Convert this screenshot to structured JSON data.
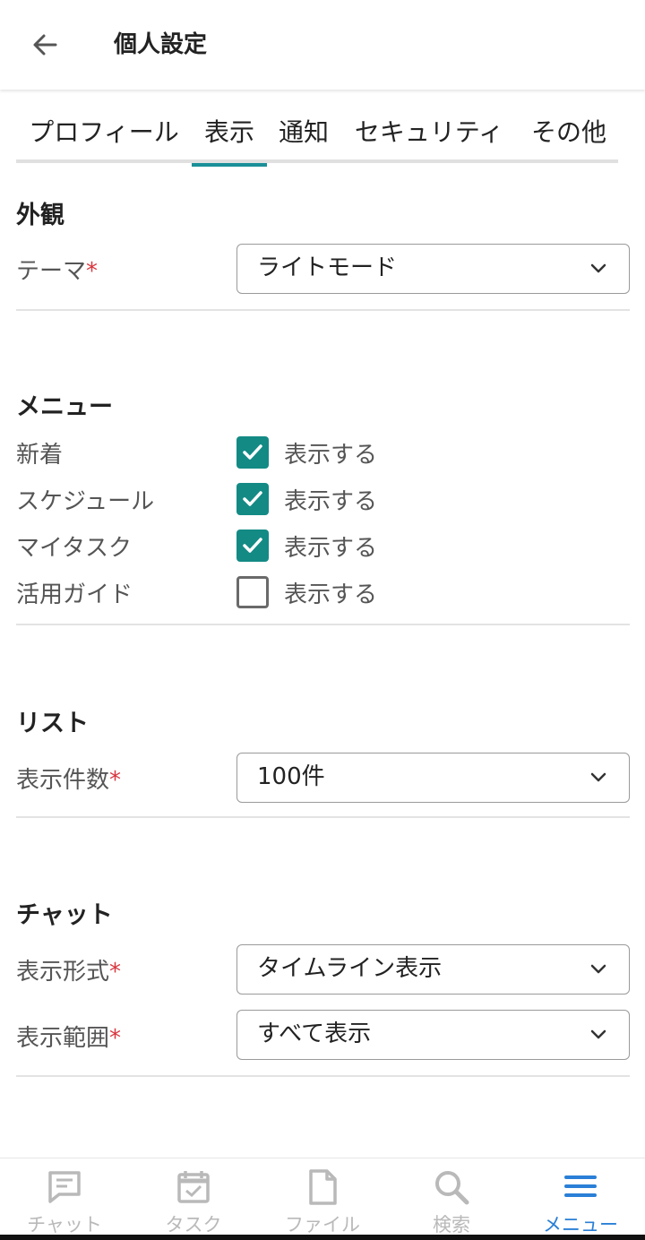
{
  "header": {
    "title": "個人設定"
  },
  "tabs": [
    {
      "label": "プロフィール",
      "active": false
    },
    {
      "label": "表示",
      "active": true
    },
    {
      "label": "通知",
      "active": false
    },
    {
      "label": "セキュリティ",
      "active": false
    },
    {
      "label": "その他",
      "active": false
    }
  ],
  "appearance": {
    "title": "外観",
    "theme": {
      "label": "テーマ",
      "required_mark": "*",
      "value": "ライトモード"
    }
  },
  "menu": {
    "title": "メニュー",
    "items": [
      {
        "label": "新着",
        "option": "表示する",
        "checked": true
      },
      {
        "label": "スケジュール",
        "option": "表示する",
        "checked": true
      },
      {
        "label": "マイタスク",
        "option": "表示する",
        "checked": true
      },
      {
        "label": "活用ガイド",
        "option": "表示する",
        "checked": false
      }
    ]
  },
  "list": {
    "title": "リスト",
    "count": {
      "label": "表示件数",
      "required_mark": "*",
      "value": "100件"
    }
  },
  "chat": {
    "title": "チャット",
    "format": {
      "label": "表示形式",
      "required_mark": "*",
      "value": "タイムライン表示"
    },
    "range": {
      "label": "表示範囲",
      "required_mark": "*",
      "value": "すべて表示"
    }
  },
  "bottom_nav": [
    {
      "label": "チャット",
      "icon": "chat-icon",
      "active": false
    },
    {
      "label": "タスク",
      "icon": "calendar-check-icon",
      "active": false
    },
    {
      "label": "ファイル",
      "icon": "file-icon",
      "active": false
    },
    {
      "label": "検索",
      "icon": "search-icon",
      "active": false
    },
    {
      "label": "メニュー",
      "icon": "menu-icon",
      "active": true
    }
  ],
  "colors": {
    "accent": "#1a8f98",
    "checkbox": "#148a85",
    "required": "#d9363e",
    "nav_active": "#2a7fd6",
    "nav_inactive": "#b9b9b9"
  }
}
